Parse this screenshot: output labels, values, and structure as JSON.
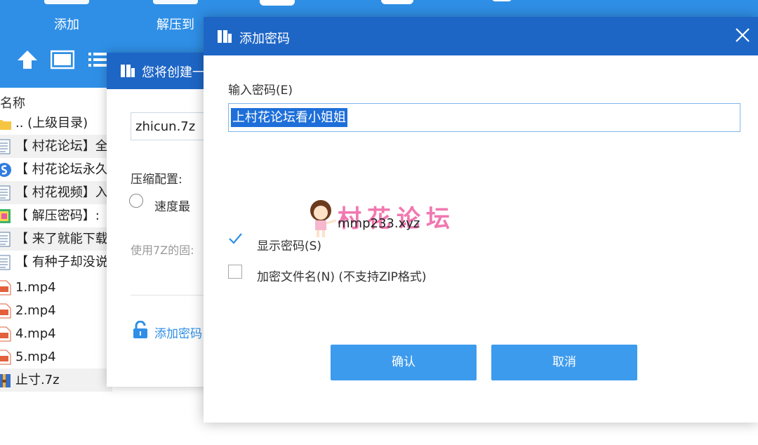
{
  "toolbar": {
    "buttons": [
      {
        "label": "添加",
        "icon": "add-icon"
      },
      {
        "label": "解压到",
        "icon": "extract-icon"
      }
    ],
    "nav_icons": [
      "up-arrow-icon",
      "view-icon",
      "list-icon"
    ],
    "background": "#2f8fe6"
  },
  "filelist": {
    "column_name": "名称",
    "rows": [
      {
        "name": ".. (上级目录)",
        "icon": "folder-icon"
      },
      {
        "name": "【 村花论坛】全",
        "icon": "text-file-icon"
      },
      {
        "name": "【 村花论坛永久",
        "icon": "sogou-icon"
      },
      {
        "name": "【 村花视频】入",
        "icon": "text-file-icon"
      },
      {
        "name": "【 解压密码】:",
        "icon": "image-file-icon"
      },
      {
        "name": "【 来了就能下载",
        "icon": "text-file-icon"
      },
      {
        "name": "【 有种子却没说",
        "icon": "text-file-icon"
      },
      {
        "name": "1.mp4",
        "icon": "mp4-icon"
      },
      {
        "name": "2.mp4",
        "icon": "mp4-icon"
      },
      {
        "name": "4.mp4",
        "icon": "mp4-icon"
      },
      {
        "name": "5.mp4",
        "icon": "mp4-icon"
      },
      {
        "name": "止寸.7z",
        "icon": "archive-icon"
      }
    ]
  },
  "create_dialog": {
    "title": "您将创建一",
    "archive_name": "zhicun.7z",
    "compress_label": "压缩配置:",
    "radio_label": "速度最",
    "hint": "使用7Z的固:",
    "add_password": "添加密码"
  },
  "pw_dialog": {
    "title": "添加密码",
    "field_label": "输入密码(E)",
    "password_value": "上村花论坛看小姐姐",
    "show_password_label": "显示密码(S)",
    "show_password_checked": true,
    "encrypt_names_label": "加密文件名(N) (不支持ZIP格式)",
    "encrypt_names_checked": false,
    "confirm_label": "确认",
    "cancel_label": "取消",
    "accent": "#1e66c6",
    "button_color": "#3d9bee"
  },
  "watermark": {
    "text": "村花论坛",
    "url": "mmp233.xyz"
  }
}
